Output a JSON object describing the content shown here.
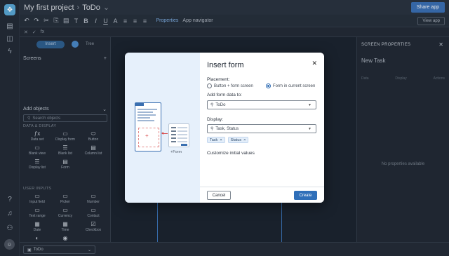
{
  "app": {
    "project_name": "My first project",
    "screen_name": "ToDo",
    "share_label": "Share app"
  },
  "toolbar": {
    "properties_label": "Properties",
    "app_navigator_label": "App navigator",
    "view_app_label": "View app",
    "fx_label": "fx"
  },
  "left_panel": {
    "tab_insert": "Insert",
    "tab_tree": "Tree",
    "screens_label": "Screens",
    "add_objects_label": "Add objects",
    "search_placeholder": "Search objects",
    "data_display_section": "DATA & DISPLAY",
    "data_display_items": [
      {
        "label": "Data set",
        "icon": "ƒx"
      },
      {
        "label": "Display form",
        "icon": "▭"
      },
      {
        "label": "Button",
        "icon": "⬭"
      },
      {
        "label": "Blank view",
        "icon": "▭"
      },
      {
        "label": "Blank list",
        "icon": "☰"
      },
      {
        "label": "Column list",
        "icon": "▤"
      },
      {
        "label": "Display list",
        "icon": "☰"
      },
      {
        "label": "Form",
        "icon": "▤"
      }
    ],
    "user_inputs_section": "USER INPUTS",
    "user_inputs_items": [
      {
        "label": "Input field",
        "icon": "▭"
      },
      {
        "label": "Picker",
        "icon": "▭"
      },
      {
        "label": "Number",
        "icon": "▭"
      },
      {
        "label": "Text range",
        "icon": "▭"
      },
      {
        "label": "Currency",
        "icon": "▭"
      },
      {
        "label": "Contact",
        "icon": "▭"
      },
      {
        "label": "Date",
        "icon": "▦"
      },
      {
        "label": "Time",
        "icon": "▦"
      },
      {
        "label": "Checkbox",
        "icon": "☑"
      },
      {
        "label": "Switch",
        "icon": "◐"
      },
      {
        "label": "Radio",
        "icon": "◉"
      }
    ]
  },
  "right_panel": {
    "title": "SCREEN PROPERTIES",
    "subtitle": "New Task",
    "tabs": [
      "Data",
      "Display",
      "Actions"
    ],
    "empty_message": "No properties available"
  },
  "bottom_bar": {
    "screen_select": "ToDo"
  },
  "dialog": {
    "title": "Insert form",
    "placement_label": "Placement:",
    "placement_options": [
      {
        "label": "Button + form screen",
        "selected": false
      },
      {
        "label": "Form in current screen",
        "selected": true
      }
    ],
    "add_data_label": "Add form data to:",
    "data_source_value": "ToDo",
    "display_label": "Display:",
    "display_value": "Task, Status",
    "display_chips": [
      "Task",
      "Status"
    ],
    "customize_label": "Customize initial values",
    "cancel_label": "Cancel",
    "create_label": "Create",
    "illustration_caption": "+Form"
  },
  "colors": {
    "accent": "#2f6fb9",
    "dialog_left_bg": "#e6f0fb",
    "app_bg": "#1f2733"
  }
}
